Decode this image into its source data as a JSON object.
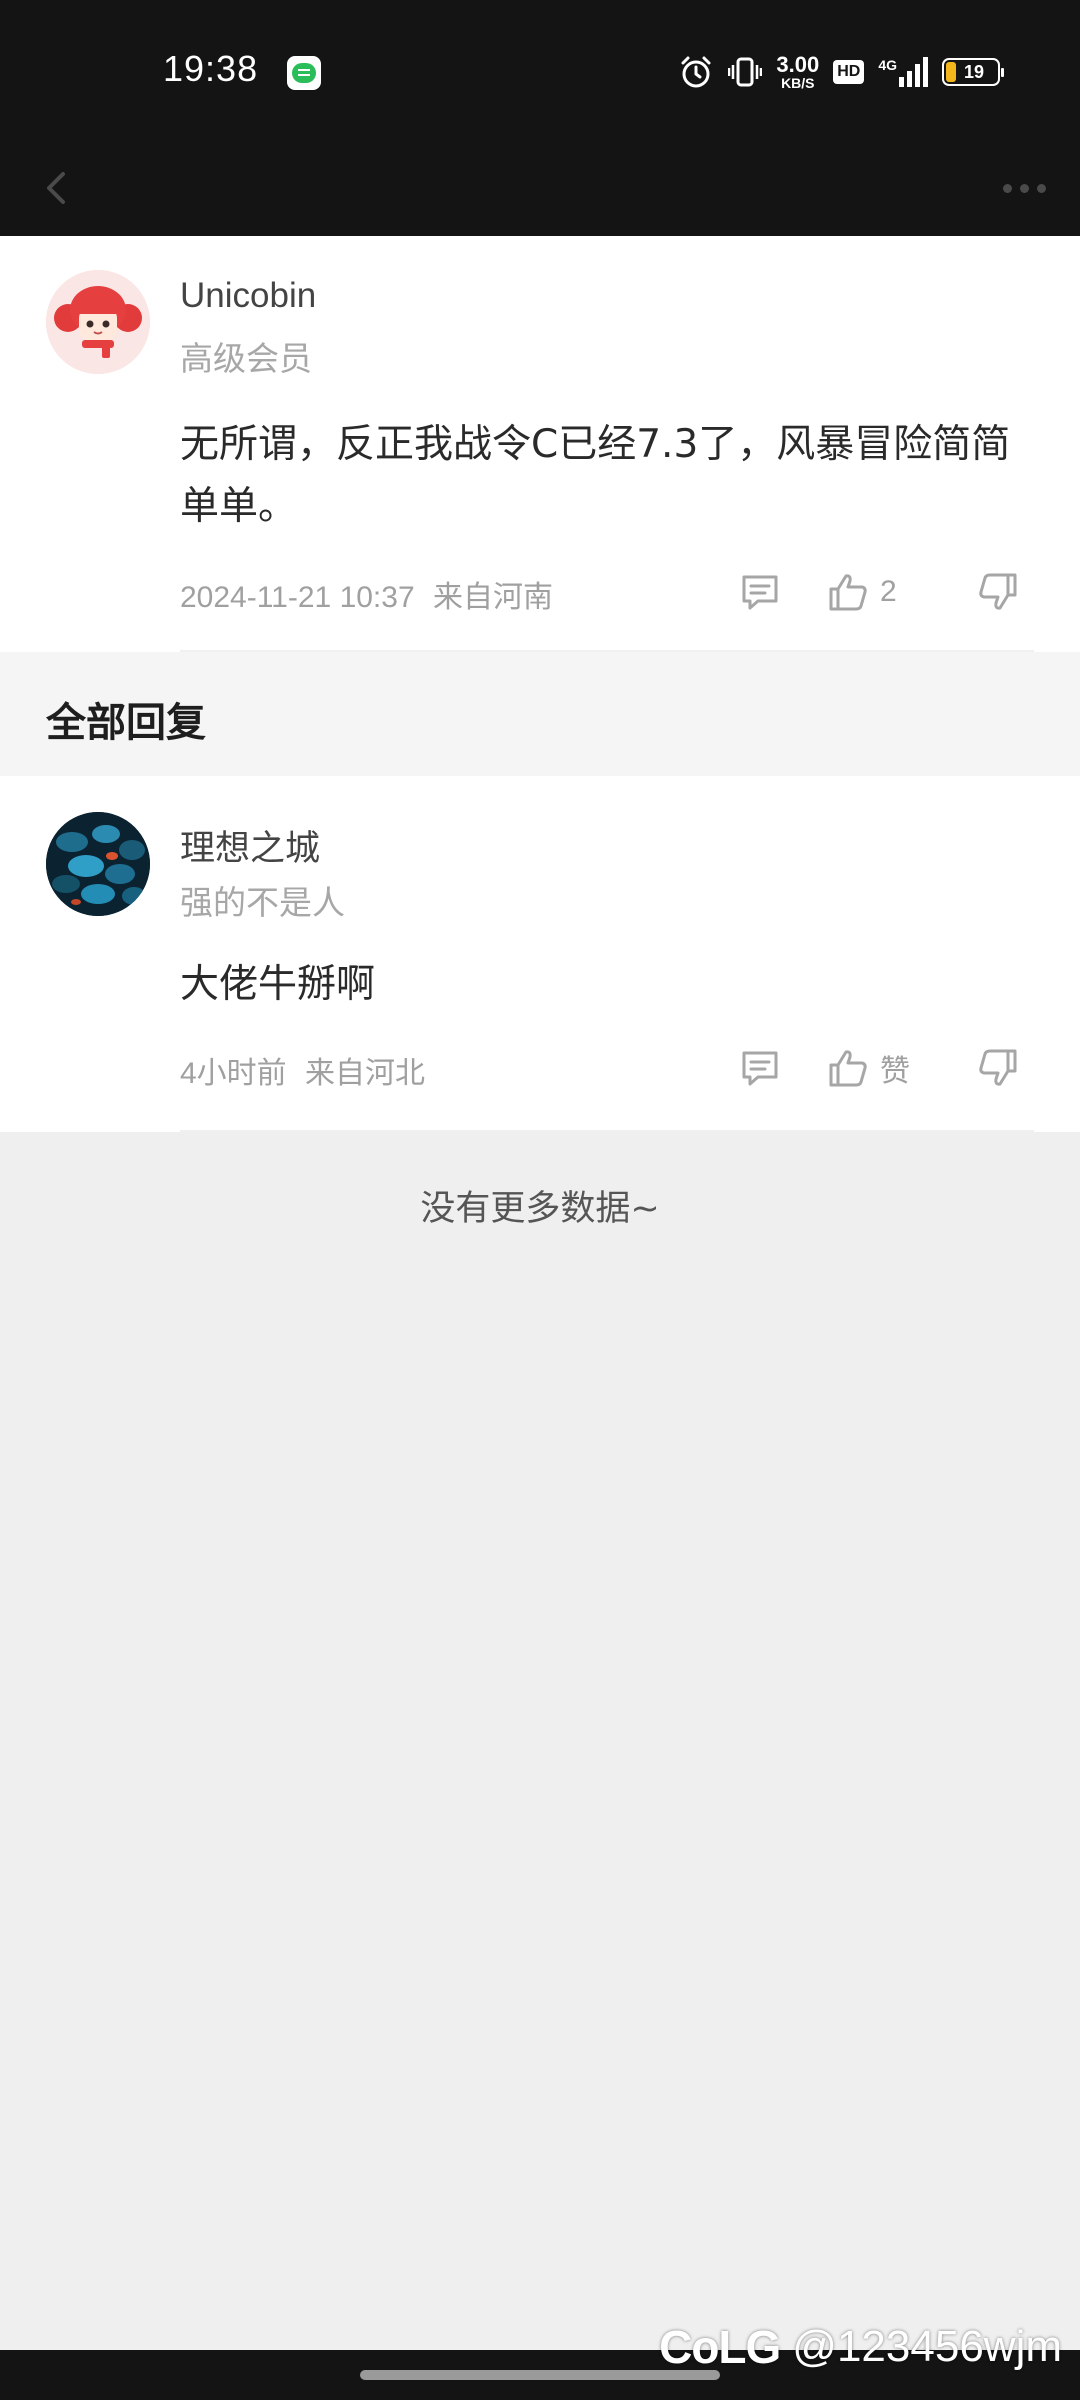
{
  "status_bar": {
    "time": "19:38",
    "net_speed_value": "3.00",
    "net_speed_unit": "KB/S",
    "hd_label": "HD",
    "network_type": "4G",
    "battery_level": "19",
    "battery_color": "#f2b51c"
  },
  "nav": {
    "back_icon": "chevron-left-icon",
    "more_icon": "more-horizontal-icon"
  },
  "main_post": {
    "user_name": "Unicobin",
    "user_role": "高级会员",
    "content": "无所谓，反正我战令C已经7.3了，风暴冒险简简单单。",
    "timestamp": "2024-11-21 10:37",
    "location": "来自河南",
    "like_count": "2"
  },
  "section": {
    "title": "全部回复"
  },
  "replies": [
    {
      "user_name": "理想之城",
      "user_signature": "强的不是人",
      "content": "大佬牛掰啊",
      "timestamp": "4小时前",
      "location": "来自河北",
      "like_label": "赞"
    }
  ],
  "footer": {
    "no_more": "没有更多数据~"
  },
  "watermark": {
    "logo": "CoLG",
    "handle": "@123456wjm"
  }
}
